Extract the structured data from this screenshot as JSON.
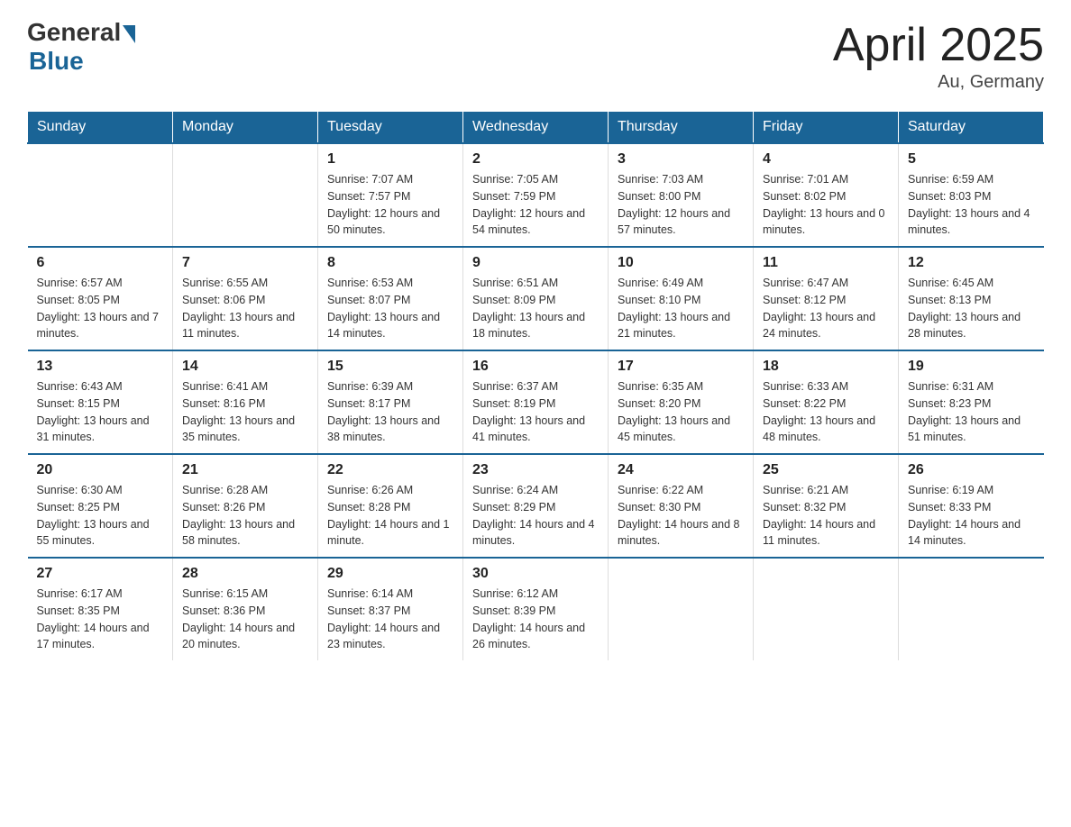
{
  "header": {
    "logo_general": "General",
    "logo_blue": "Blue",
    "month_title": "April 2025",
    "location": "Au, Germany"
  },
  "days_of_week": [
    "Sunday",
    "Monday",
    "Tuesday",
    "Wednesday",
    "Thursday",
    "Friday",
    "Saturday"
  ],
  "weeks": [
    [
      {
        "day": "",
        "sunrise": "",
        "sunset": "",
        "daylight": ""
      },
      {
        "day": "",
        "sunrise": "",
        "sunset": "",
        "daylight": ""
      },
      {
        "day": "1",
        "sunrise": "Sunrise: 7:07 AM",
        "sunset": "Sunset: 7:57 PM",
        "daylight": "Daylight: 12 hours and 50 minutes."
      },
      {
        "day": "2",
        "sunrise": "Sunrise: 7:05 AM",
        "sunset": "Sunset: 7:59 PM",
        "daylight": "Daylight: 12 hours and 54 minutes."
      },
      {
        "day": "3",
        "sunrise": "Sunrise: 7:03 AM",
        "sunset": "Sunset: 8:00 PM",
        "daylight": "Daylight: 12 hours and 57 minutes."
      },
      {
        "day": "4",
        "sunrise": "Sunrise: 7:01 AM",
        "sunset": "Sunset: 8:02 PM",
        "daylight": "Daylight: 13 hours and 0 minutes."
      },
      {
        "day": "5",
        "sunrise": "Sunrise: 6:59 AM",
        "sunset": "Sunset: 8:03 PM",
        "daylight": "Daylight: 13 hours and 4 minutes."
      }
    ],
    [
      {
        "day": "6",
        "sunrise": "Sunrise: 6:57 AM",
        "sunset": "Sunset: 8:05 PM",
        "daylight": "Daylight: 13 hours and 7 minutes."
      },
      {
        "day": "7",
        "sunrise": "Sunrise: 6:55 AM",
        "sunset": "Sunset: 8:06 PM",
        "daylight": "Daylight: 13 hours and 11 minutes."
      },
      {
        "day": "8",
        "sunrise": "Sunrise: 6:53 AM",
        "sunset": "Sunset: 8:07 PM",
        "daylight": "Daylight: 13 hours and 14 minutes."
      },
      {
        "day": "9",
        "sunrise": "Sunrise: 6:51 AM",
        "sunset": "Sunset: 8:09 PM",
        "daylight": "Daylight: 13 hours and 18 minutes."
      },
      {
        "day": "10",
        "sunrise": "Sunrise: 6:49 AM",
        "sunset": "Sunset: 8:10 PM",
        "daylight": "Daylight: 13 hours and 21 minutes."
      },
      {
        "day": "11",
        "sunrise": "Sunrise: 6:47 AM",
        "sunset": "Sunset: 8:12 PM",
        "daylight": "Daylight: 13 hours and 24 minutes."
      },
      {
        "day": "12",
        "sunrise": "Sunrise: 6:45 AM",
        "sunset": "Sunset: 8:13 PM",
        "daylight": "Daylight: 13 hours and 28 minutes."
      }
    ],
    [
      {
        "day": "13",
        "sunrise": "Sunrise: 6:43 AM",
        "sunset": "Sunset: 8:15 PM",
        "daylight": "Daylight: 13 hours and 31 minutes."
      },
      {
        "day": "14",
        "sunrise": "Sunrise: 6:41 AM",
        "sunset": "Sunset: 8:16 PM",
        "daylight": "Daylight: 13 hours and 35 minutes."
      },
      {
        "day": "15",
        "sunrise": "Sunrise: 6:39 AM",
        "sunset": "Sunset: 8:17 PM",
        "daylight": "Daylight: 13 hours and 38 minutes."
      },
      {
        "day": "16",
        "sunrise": "Sunrise: 6:37 AM",
        "sunset": "Sunset: 8:19 PM",
        "daylight": "Daylight: 13 hours and 41 minutes."
      },
      {
        "day": "17",
        "sunrise": "Sunrise: 6:35 AM",
        "sunset": "Sunset: 8:20 PM",
        "daylight": "Daylight: 13 hours and 45 minutes."
      },
      {
        "day": "18",
        "sunrise": "Sunrise: 6:33 AM",
        "sunset": "Sunset: 8:22 PM",
        "daylight": "Daylight: 13 hours and 48 minutes."
      },
      {
        "day": "19",
        "sunrise": "Sunrise: 6:31 AM",
        "sunset": "Sunset: 8:23 PM",
        "daylight": "Daylight: 13 hours and 51 minutes."
      }
    ],
    [
      {
        "day": "20",
        "sunrise": "Sunrise: 6:30 AM",
        "sunset": "Sunset: 8:25 PM",
        "daylight": "Daylight: 13 hours and 55 minutes."
      },
      {
        "day": "21",
        "sunrise": "Sunrise: 6:28 AM",
        "sunset": "Sunset: 8:26 PM",
        "daylight": "Daylight: 13 hours and 58 minutes."
      },
      {
        "day": "22",
        "sunrise": "Sunrise: 6:26 AM",
        "sunset": "Sunset: 8:28 PM",
        "daylight": "Daylight: 14 hours and 1 minute."
      },
      {
        "day": "23",
        "sunrise": "Sunrise: 6:24 AM",
        "sunset": "Sunset: 8:29 PM",
        "daylight": "Daylight: 14 hours and 4 minutes."
      },
      {
        "day": "24",
        "sunrise": "Sunrise: 6:22 AM",
        "sunset": "Sunset: 8:30 PM",
        "daylight": "Daylight: 14 hours and 8 minutes."
      },
      {
        "day": "25",
        "sunrise": "Sunrise: 6:21 AM",
        "sunset": "Sunset: 8:32 PM",
        "daylight": "Daylight: 14 hours and 11 minutes."
      },
      {
        "day": "26",
        "sunrise": "Sunrise: 6:19 AM",
        "sunset": "Sunset: 8:33 PM",
        "daylight": "Daylight: 14 hours and 14 minutes."
      }
    ],
    [
      {
        "day": "27",
        "sunrise": "Sunrise: 6:17 AM",
        "sunset": "Sunset: 8:35 PM",
        "daylight": "Daylight: 14 hours and 17 minutes."
      },
      {
        "day": "28",
        "sunrise": "Sunrise: 6:15 AM",
        "sunset": "Sunset: 8:36 PM",
        "daylight": "Daylight: 14 hours and 20 minutes."
      },
      {
        "day": "29",
        "sunrise": "Sunrise: 6:14 AM",
        "sunset": "Sunset: 8:37 PM",
        "daylight": "Daylight: 14 hours and 23 minutes."
      },
      {
        "day": "30",
        "sunrise": "Sunrise: 6:12 AM",
        "sunset": "Sunset: 8:39 PM",
        "daylight": "Daylight: 14 hours and 26 minutes."
      },
      {
        "day": "",
        "sunrise": "",
        "sunset": "",
        "daylight": ""
      },
      {
        "day": "",
        "sunrise": "",
        "sunset": "",
        "daylight": ""
      },
      {
        "day": "",
        "sunrise": "",
        "sunset": "",
        "daylight": ""
      }
    ]
  ]
}
